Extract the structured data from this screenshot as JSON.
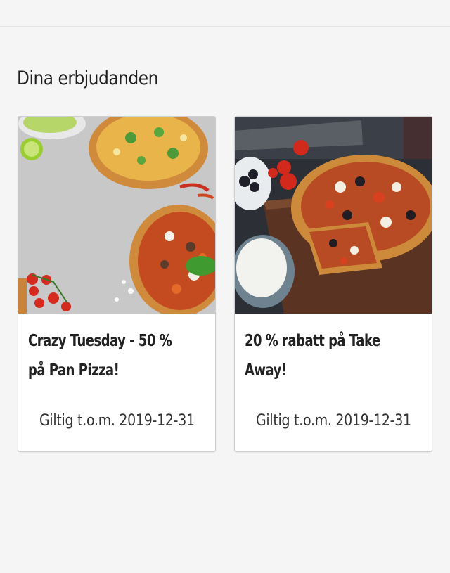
{
  "section": {
    "title": "Dina erbjudanden"
  },
  "offers": [
    {
      "title": "Crazy Tuesday - 50 % på Pan Pizza!",
      "validity": "Giltig t.o.m. 2019-12-31",
      "image": "pizzas-on-concrete-photo"
    },
    {
      "title": "20 % rabatt på Take Away!",
      "validity": "Giltig t.o.m. 2019-12-31",
      "image": "pan-pizza-on-board-photo"
    }
  ],
  "colors": {
    "background": "#f5f5f5",
    "card": "#ffffff",
    "border": "#cfcfcf",
    "text": "#222222"
  }
}
